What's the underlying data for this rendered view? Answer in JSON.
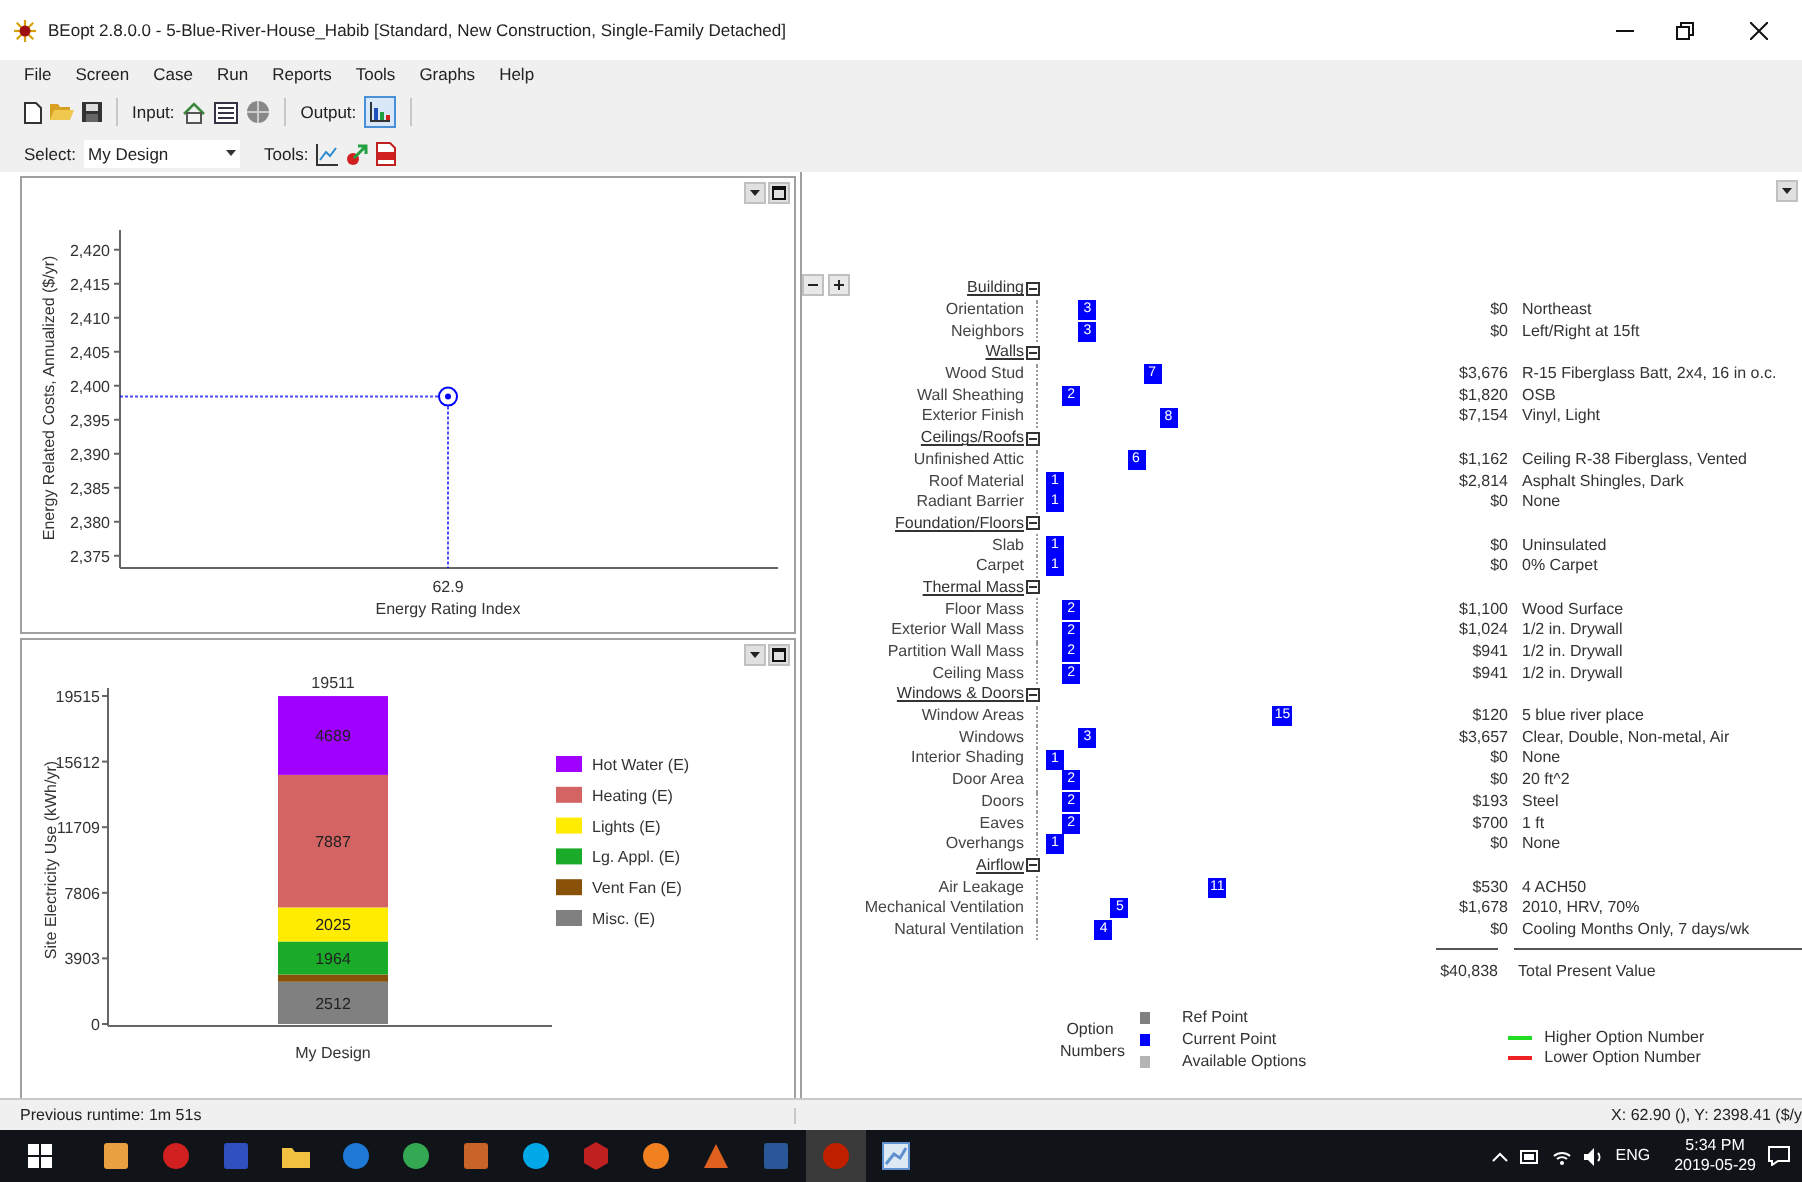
{
  "window": {
    "title": "BEopt 2.8.0.0 - 5-Blue-River-House_Habib [Standard, New Construction, Single-Family Detached]"
  },
  "menu": [
    "File",
    "Screen",
    "Case",
    "Run",
    "Reports",
    "Tools",
    "Graphs",
    "Help"
  ],
  "toolbar": {
    "input_label": "Input:",
    "output_label": "Output:",
    "output_selected": true
  },
  "select_bar": {
    "label": "Select:",
    "value": "My Design",
    "tools_label": "Tools:"
  },
  "cost_chart": {
    "chart_data": {
      "type": "scatter",
      "xlabel": "Energy Rating Index",
      "ylabel": "Energy Related Costs, Annualized ($/yr)",
      "categories": [
        "62.9"
      ],
      "series": [
        {
          "color": "#0000ff",
          "values": [
            2398.4
          ]
        }
      ],
      "ref_lines": [
        {
          "axis": "y",
          "value": 2398.4
        }
      ],
      "ylim": [
        2373.2,
        2422.9
      ],
      "yticks": [
        {
          "value": 2375,
          "label": "2,375"
        },
        {
          "value": 2380,
          "label": "2,380"
        },
        {
          "value": 2385,
          "label": "2,385"
        },
        {
          "value": 2390,
          "label": "2,390"
        },
        {
          "value": 2395,
          "label": "2,395"
        },
        {
          "value": 2400,
          "label": "2,400"
        },
        {
          "value": 2405,
          "label": "2,405"
        },
        {
          "value": 2410,
          "label": "2,410"
        },
        {
          "value": 2415,
          "label": "2,415"
        },
        {
          "value": 2420,
          "label": "2,420"
        }
      ]
    }
  },
  "electricity_chart": {
    "total_label": "19511",
    "chart_data": {
      "type": "bar",
      "stacked": true,
      "ylabel": "Site Electricity Use (kWh/yr)",
      "categories": [
        "My Design"
      ],
      "ylim": [
        0,
        19515
      ],
      "yticks": [
        0,
        3903,
        7806,
        11709,
        15612,
        19515
      ],
      "legend": true,
      "series": [
        {
          "name": "Hot Water (E)",
          "color": "#a000ff",
          "values": [
            4689
          ],
          "value_labels": [
            "4689"
          ]
        },
        {
          "name": "Heating (E)",
          "color": "#d46464",
          "values": [
            7887
          ],
          "value_labels": [
            "7887"
          ]
        },
        {
          "name": "Lights (E)",
          "color": "#ffec00",
          "values": [
            2025
          ],
          "value_labels": [
            "2025"
          ]
        },
        {
          "name": "Lg. Appl. (E)",
          "color": "#1aac28",
          "values": [
            1964
          ],
          "value_labels": [
            "1964"
          ]
        },
        {
          "name": "Vent Fan (E)",
          "color": "#8a5208",
          "values": [
            434
          ],
          "value_labels": [
            null
          ]
        },
        {
          "name": "Misc. (E)",
          "color": "#808080",
          "values": [
            2512
          ],
          "value_labels": [
            "2512"
          ]
        }
      ]
    }
  },
  "option_tree": {
    "groups": [
      {
        "title": "Building",
        "expanded": true,
        "items": [
          {
            "name": "Orientation",
            "option": "3",
            "cost": "$0",
            "description": "Northeast"
          },
          {
            "name": "Neighbors",
            "option": "3",
            "cost": "$0",
            "description": "Left/Right at 15ft"
          }
        ]
      },
      {
        "title": "Walls",
        "expanded": true,
        "items": [
          {
            "name": "Wood Stud",
            "option": "7",
            "cost": "$3,676",
            "description": "R-15 Fiberglass Batt, 2x4, 16 in o.c."
          },
          {
            "name": "Wall Sheathing",
            "option": "2",
            "cost": "$1,820",
            "description": "OSB"
          },
          {
            "name": "Exterior Finish",
            "option": "8",
            "cost": "$7,154",
            "description": "Vinyl, Light"
          }
        ]
      },
      {
        "title": "Ceilings/Roofs",
        "expanded": true,
        "items": [
          {
            "name": "Unfinished Attic",
            "option": "6",
            "cost": "$1,162",
            "description": "Ceiling R-38 Fiberglass, Vented"
          },
          {
            "name": "Roof Material",
            "option": "1",
            "cost": "$2,814",
            "description": "Asphalt Shingles, Dark"
          },
          {
            "name": "Radiant Barrier",
            "option": "1",
            "cost": "$0",
            "description": "None"
          }
        ]
      },
      {
        "title": "Foundation/Floors",
        "expanded": true,
        "items": [
          {
            "name": "Slab",
            "option": "1",
            "cost": "$0",
            "description": "Uninsulated"
          },
          {
            "name": "Carpet",
            "option": "1",
            "cost": "$0",
            "description": "0% Carpet"
          }
        ]
      },
      {
        "title": "Thermal Mass",
        "expanded": true,
        "items": [
          {
            "name": "Floor Mass",
            "option": "2",
            "cost": "$1,100",
            "description": "Wood Surface"
          },
          {
            "name": "Exterior Wall Mass",
            "option": "2",
            "cost": "$1,024",
            "description": "1/2 in. Drywall"
          },
          {
            "name": "Partition Wall Mass",
            "option": "2",
            "cost": "$941",
            "description": "1/2 in. Drywall"
          },
          {
            "name": "Ceiling Mass",
            "option": "2",
            "cost": "$941",
            "description": "1/2 in. Drywall"
          }
        ]
      },
      {
        "title": "Windows & Doors",
        "expanded": true,
        "items": [
          {
            "name": "Window Areas",
            "option": "15",
            "cost": "$120",
            "description": "5 blue river place"
          },
          {
            "name": "Windows",
            "option": "3",
            "cost": "$3,657",
            "description": "Clear, Double, Non-metal, Air"
          },
          {
            "name": "Interior Shading",
            "option": "1",
            "cost": "$0",
            "description": "None"
          },
          {
            "name": "Door Area",
            "option": "2",
            "cost": "$0",
            "description": "20 ft^2"
          },
          {
            "name": "Doors",
            "option": "2",
            "cost": "$193",
            "description": "Steel"
          },
          {
            "name": "Eaves",
            "option": "2",
            "cost": "$700",
            "description": "1 ft"
          },
          {
            "name": "Overhangs",
            "option": "1",
            "cost": "$0",
            "description": "None"
          }
        ]
      },
      {
        "title": "Airflow",
        "expanded": true,
        "items": [
          {
            "name": "Air Leakage",
            "option": "11",
            "cost": "$530",
            "description": "4 ACH50"
          },
          {
            "name": "Mechanical Ventilation",
            "option": "5",
            "cost": "$1,678",
            "description": "2010, HRV, 70%"
          },
          {
            "name": "Natural Ventilation",
            "option": "4",
            "cost": "$0",
            "description": "Cooling Months Only, 7 days/wk"
          }
        ]
      }
    ]
  },
  "total": {
    "cost": "$40,838",
    "label": "Total Present Value"
  },
  "option_legend": {
    "title": "Option Numbers",
    "items": [
      {
        "label": "Ref Point",
        "color": "#808080"
      },
      {
        "label": "Current Point",
        "color": "#0000ff"
      },
      {
        "label": "Available Options",
        "color": "#b4b4b4"
      }
    ]
  },
  "change_legend": [
    {
      "label": "Higher Option Number",
      "color": "#22dd22"
    },
    {
      "label": "Lower Option Number",
      "color": "#ee2222"
    }
  ],
  "status_bar": {
    "left": "Previous runtime: 1m 51s",
    "right": "X: 62.90 (), Y: 2398.41 ($/y"
  },
  "taskbar": {
    "language": "ENG",
    "time": "5:34 PM",
    "date": "2019-05-29"
  }
}
